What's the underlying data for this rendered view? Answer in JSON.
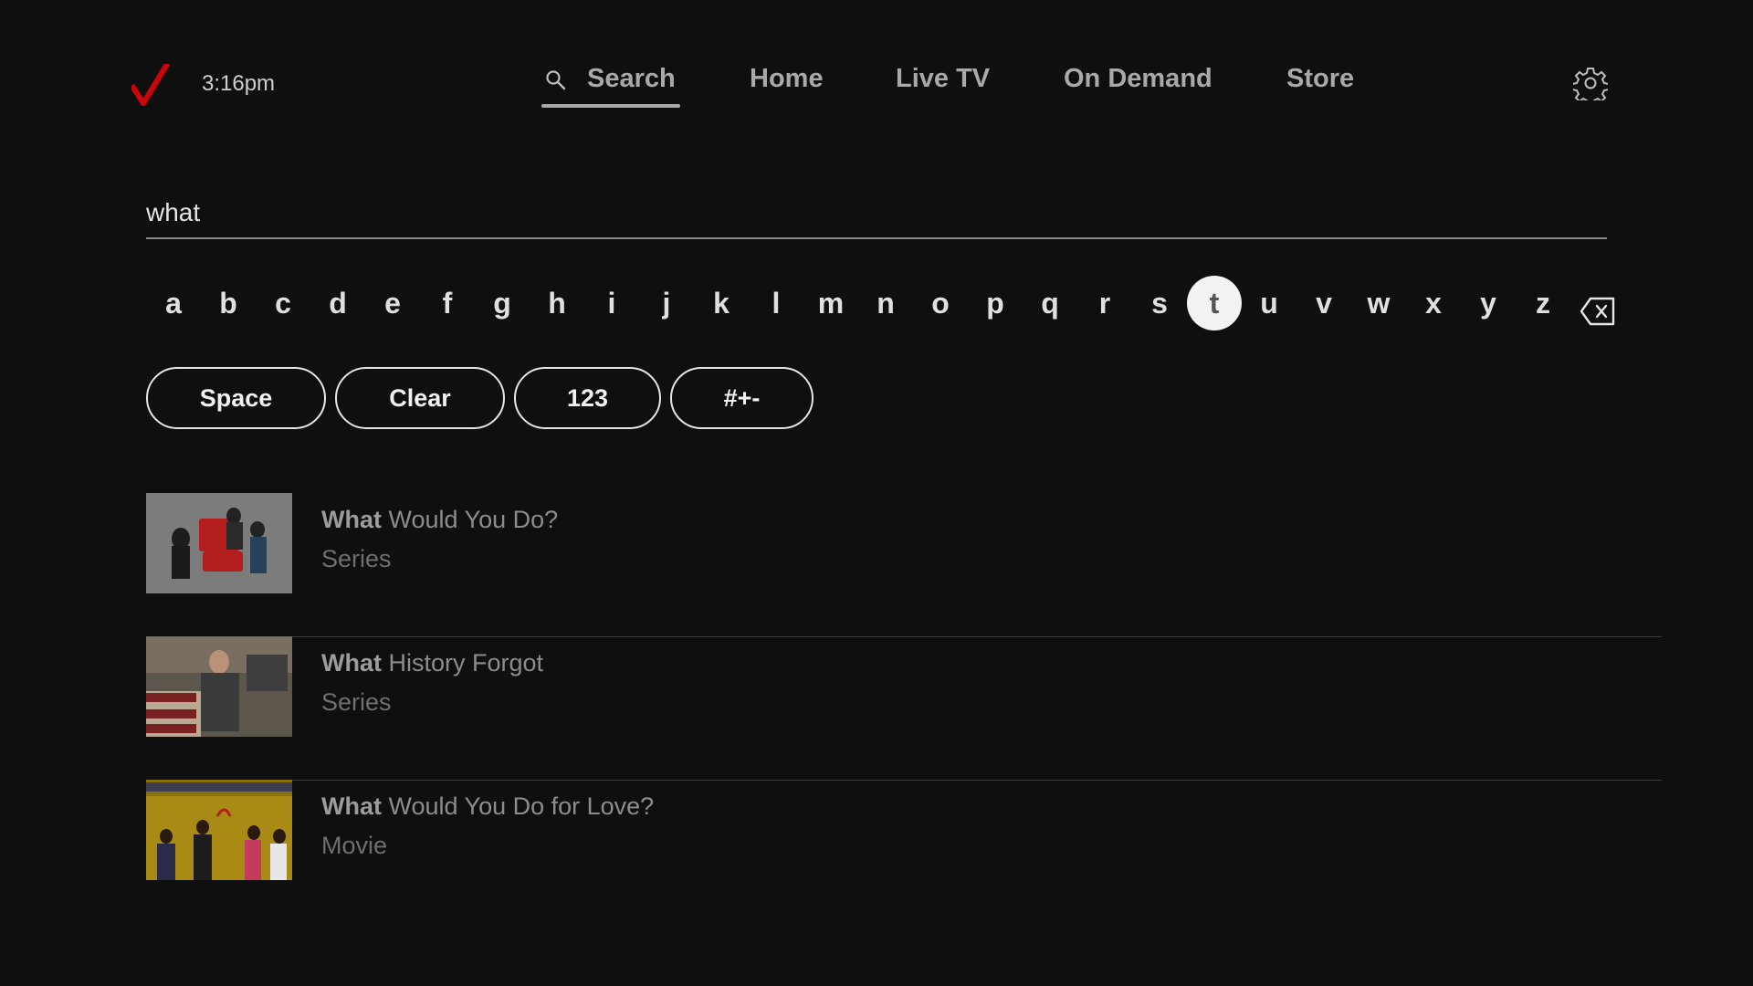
{
  "header": {
    "time": "3:16pm",
    "nav": [
      {
        "label": "Search",
        "active": true
      },
      {
        "label": "Home"
      },
      {
        "label": "Live TV"
      },
      {
        "label": "On Demand"
      },
      {
        "label": "Store"
      }
    ],
    "icons": {
      "logo": "verizon-check-logo",
      "search": "search-icon",
      "settings": "gear-icon"
    },
    "brand_color": "#cd040b"
  },
  "search": {
    "query": "what"
  },
  "keyboard": {
    "letters": [
      "a",
      "b",
      "c",
      "d",
      "e",
      "f",
      "g",
      "h",
      "i",
      "j",
      "k",
      "l",
      "m",
      "n",
      "o",
      "p",
      "q",
      "r",
      "s",
      "t",
      "u",
      "v",
      "w",
      "x",
      "y",
      "z"
    ],
    "focused_key": "t",
    "buttons": [
      "Space",
      "Clear",
      "123",
      "#+-"
    ]
  },
  "results": [
    {
      "title_match": "What",
      "title_rest": " Would You Do?",
      "type": "Series",
      "thumb": "what-would-you-do-thumbnail"
    },
    {
      "title_match": "What",
      "title_rest": " History Forgot",
      "type": "Series",
      "thumb": "what-history-forgot-thumbnail"
    },
    {
      "title_match": "What",
      "title_rest": " Would You Do for Love?",
      "type": "Movie",
      "thumb": "what-would-you-do-for-love-thumbnail"
    }
  ]
}
